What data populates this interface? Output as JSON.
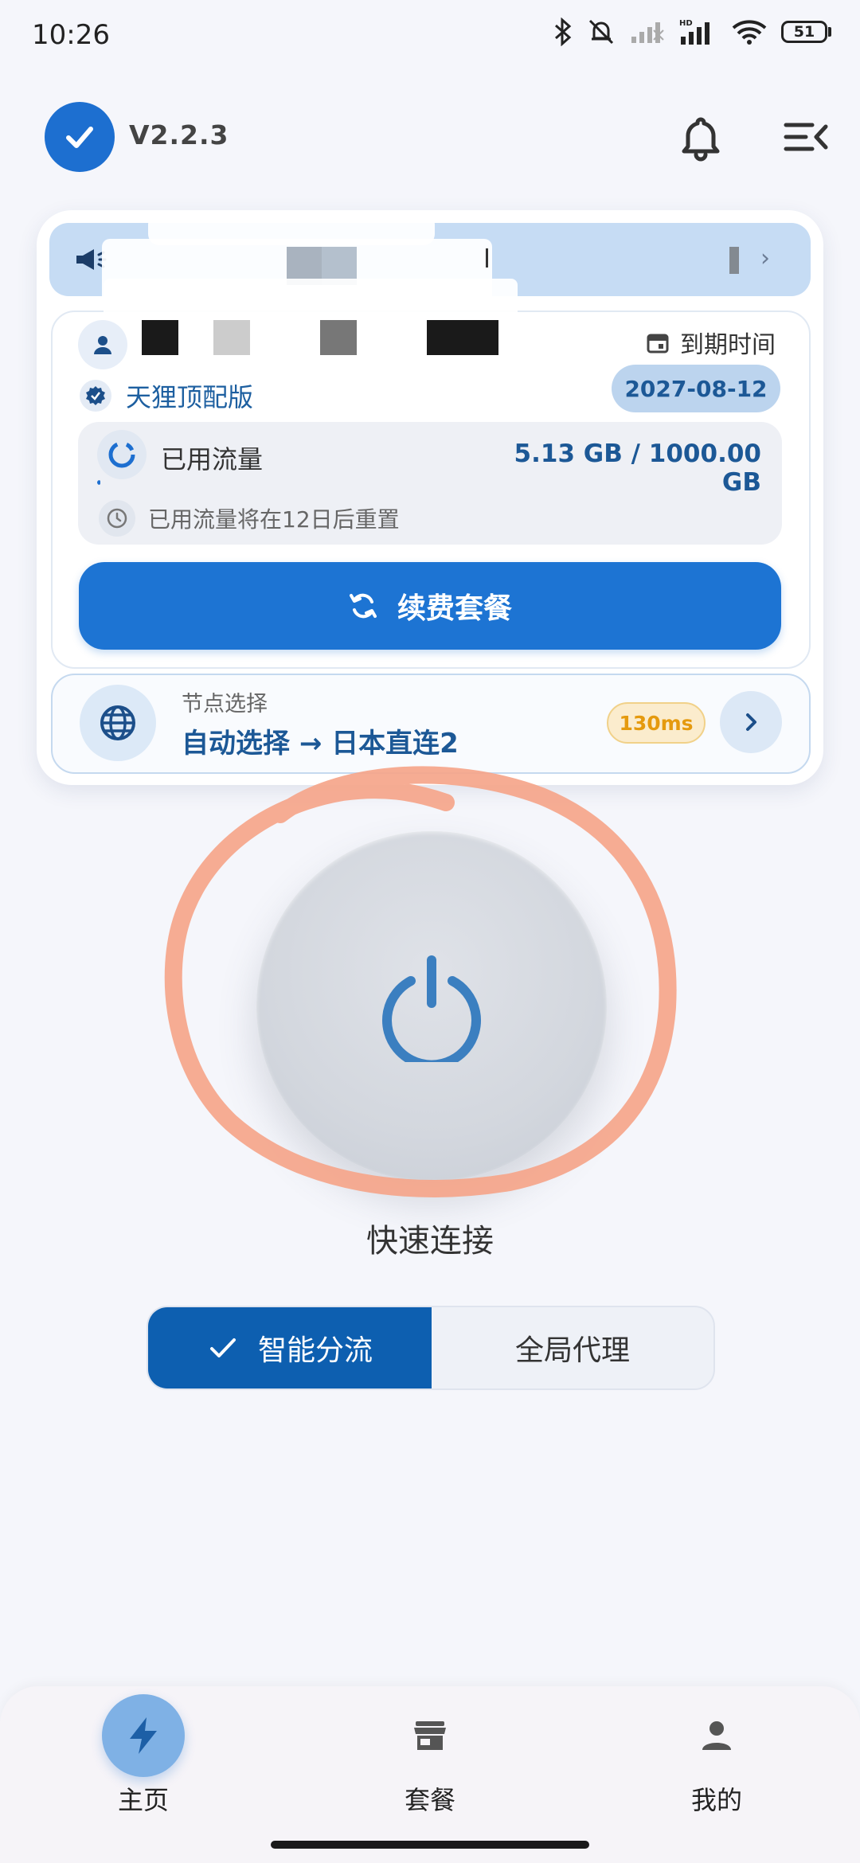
{
  "status_bar": {
    "time": "10:26",
    "battery": "51"
  },
  "header": {
    "version": "V2.2.3"
  },
  "account": {
    "expire_label": "到期时间",
    "expire_date": "2027-08-12",
    "plan_name": "天狸顶配版"
  },
  "usage": {
    "label": "已用流量",
    "value": "5.13 GB / 1000.00 GB",
    "used_fraction": 0.005,
    "reset_text": "已用流量将在12日后重置"
  },
  "renew_button": "续费套餐",
  "node": {
    "caption": "节点选择",
    "name": "自动选择 → 日本直连2",
    "latency": "130ms"
  },
  "connect": {
    "label": "快速连接"
  },
  "mode": {
    "active": "智能分流",
    "inactive": "全局代理"
  },
  "bottom_nav": [
    {
      "label": "主页",
      "icon": "bolt-icon",
      "active": true
    },
    {
      "label": "套餐",
      "icon": "store-icon",
      "active": false
    },
    {
      "label": "我的",
      "icon": "person-icon",
      "active": false
    }
  ],
  "colors": {
    "primary": "#1d74d3",
    "primary_dark": "#0d5fb0",
    "accent_text": "#1c5896",
    "latency": "#e59a0e",
    "annotation_stroke": "#f5a58a"
  }
}
